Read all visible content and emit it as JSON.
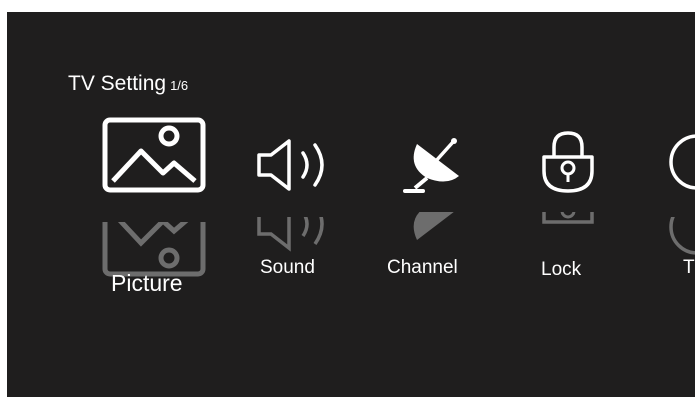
{
  "header": {
    "title": "TV Setting",
    "page_indicator": "1/6"
  },
  "menu": {
    "items": [
      {
        "label": "Picture",
        "icon": "picture-icon",
        "selected": true
      },
      {
        "label": "Sound",
        "icon": "speaker-icon",
        "selected": false
      },
      {
        "label": "Channel",
        "icon": "satellite-dish-icon",
        "selected": false
      },
      {
        "label": "Lock",
        "icon": "lock-icon",
        "selected": false
      },
      {
        "label": "T",
        "icon": "clock-icon",
        "selected": false
      }
    ]
  },
  "colors": {
    "background": "#1f1e1e",
    "foreground": "#ffffff"
  }
}
